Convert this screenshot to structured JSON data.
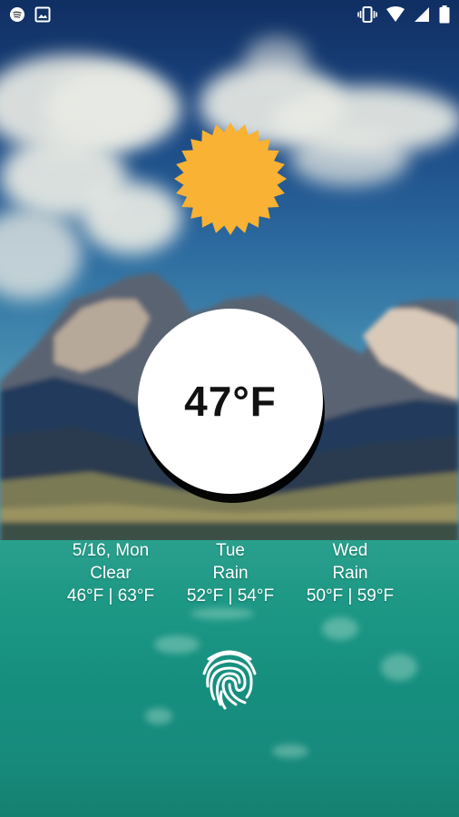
{
  "statusbar": {
    "left_icons": [
      "spotify-icon",
      "image-icon"
    ],
    "right_icons": [
      "vibrate-icon",
      "wifi-icon",
      "signal-icon",
      "battery-icon"
    ]
  },
  "weather": {
    "current_icon": "sun-icon",
    "current_temp": "47°F"
  },
  "forecast": [
    {
      "day": "5/16, Mon",
      "condition": "Clear",
      "range": "46°F | 63°F"
    },
    {
      "day": "Tue",
      "condition": "Rain",
      "range": "52°F | 54°F"
    },
    {
      "day": "Wed",
      "condition": "Rain",
      "range": "50°F | 59°F"
    }
  ],
  "unlock": {
    "icon": "fingerprint-icon"
  },
  "colors": {
    "sun": "#f9b233",
    "water": "#1e9986",
    "sky": "#1c4a85"
  }
}
